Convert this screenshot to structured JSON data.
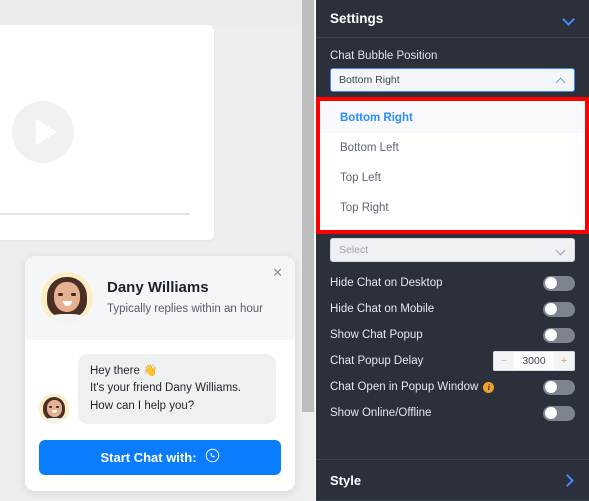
{
  "preview": {
    "video": {
      "play_icon": "play-icon"
    },
    "widget": {
      "agent_name": "Dany Williams",
      "agent_status": "Typically replies within an hour",
      "close_icon": "close-icon",
      "message": "Hey there 👋\nIt's your friend Dany Williams. How can I help you?",
      "message_line1": "Hey there 👋",
      "message_line2": "It's your friend Dany Williams. How can I help you?",
      "start_button_label": "Start Chat with:",
      "start_button_icon": "viber-icon",
      "accent_color": "#0a7cff"
    }
  },
  "panel": {
    "header": {
      "title": "Settings",
      "chevron_icon": "chevron-down-icon"
    },
    "chat_bubble_position": {
      "label": "Chat Bubble Position",
      "selected": "Bottom Right",
      "chevron_icon": "chevron-up-icon",
      "options": [
        {
          "label": "Bottom Right",
          "selected": true
        },
        {
          "label": "Bottom Left",
          "selected": false
        },
        {
          "label": "Top Left",
          "selected": false
        },
        {
          "label": "Top Right",
          "selected": false
        }
      ],
      "highlight_color": "#ff0000"
    },
    "secondary_select": {
      "placeholder": "Select",
      "chevron_icon": "chevron-down-icon"
    },
    "toggles": [
      {
        "label": "Hide Chat on Desktop",
        "on": false,
        "info": false
      },
      {
        "label": "Hide Chat on Mobile",
        "on": false,
        "info": false
      },
      {
        "label": "Show Chat Popup",
        "on": false,
        "info": false
      }
    ],
    "popup_delay": {
      "label": "Chat Popup Delay",
      "value": "3000",
      "minus_label": "−",
      "plus_label": "+"
    },
    "toggles2": [
      {
        "label": "Chat Open in Popup Window",
        "on": false,
        "info": true,
        "info_icon_label": "i"
      },
      {
        "label": "Show Online/Offline",
        "on": false,
        "info": false
      }
    ],
    "footer": {
      "title": "Style",
      "chevron_icon": "chevron-right-icon"
    }
  }
}
